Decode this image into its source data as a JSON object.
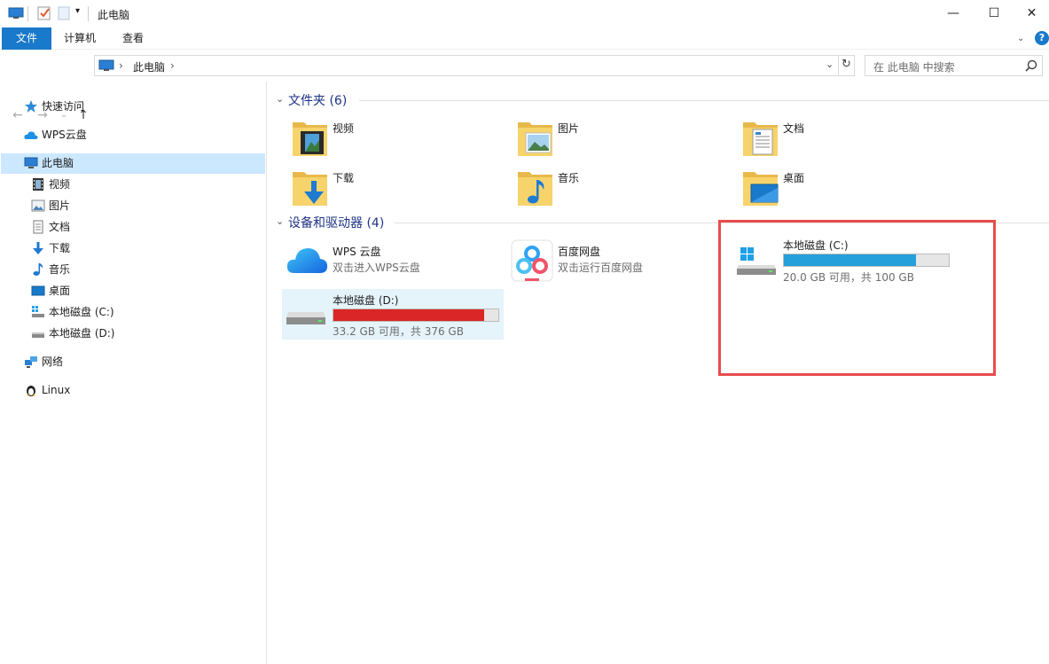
{
  "window": {
    "title": "此电脑",
    "minimize_glyph": "—",
    "maximize_glyph": "☐",
    "close_glyph": "✕"
  },
  "ribbon": {
    "tabs": [
      {
        "label": "文件"
      },
      {
        "label": "计算机"
      },
      {
        "label": "查看"
      }
    ],
    "help_glyph": "?"
  },
  "address_bar": {
    "path": "此电脑",
    "separator": "›",
    "search_placeholder": "在 此电脑 中搜索"
  },
  "sidebar": {
    "items": [
      {
        "label": "快速访问",
        "icon": "star-icon"
      },
      {
        "label": "WPS云盘",
        "icon": "cloud-icon"
      },
      {
        "label": "此电脑",
        "icon": "computer-icon",
        "selected": true
      },
      {
        "label": "视频",
        "icon": "video-icon"
      },
      {
        "label": "图片",
        "icon": "picture-icon"
      },
      {
        "label": "文档",
        "icon": "document-icon"
      },
      {
        "label": "下载",
        "icon": "download-icon"
      },
      {
        "label": "音乐",
        "icon": "music-icon"
      },
      {
        "label": "桌面",
        "icon": "desktop-icon"
      },
      {
        "label": "本地磁盘 (C:)",
        "icon": "drive-c-icon"
      },
      {
        "label": "本地磁盘 (D:)",
        "icon": "drive-icon"
      },
      {
        "label": "网络",
        "icon": "network-icon"
      },
      {
        "label": "Linux",
        "icon": "linux-icon"
      }
    ]
  },
  "folders_group": {
    "title": "文件夹 (6)",
    "items": [
      {
        "label": "视频",
        "icon": "video-folder-icon"
      },
      {
        "label": "图片",
        "icon": "picture-folder-icon"
      },
      {
        "label": "文档",
        "icon": "document-folder-icon"
      },
      {
        "label": "下载",
        "icon": "download-folder-icon"
      },
      {
        "label": "音乐",
        "icon": "music-folder-icon"
      },
      {
        "label": "桌面",
        "icon": "desktop-folder-icon"
      }
    ]
  },
  "devices_group": {
    "title": "设备和驱动器 (4)",
    "items": [
      {
        "name": "WPS 云盘",
        "subtitle": "双击进入WPS云盘",
        "icon": "wps-cloud-icon"
      },
      {
        "name": "百度网盘",
        "subtitle": "双击运行百度网盘",
        "icon": "baidu-netdisk-icon"
      },
      {
        "name": "本地磁盘 (C:)",
        "subtitle": "20.0 GB 可用，共 100 GB",
        "icon": "drive-c-icon",
        "used_fraction": 0.8,
        "bar_color": "#26a0da"
      },
      {
        "name": "本地磁盘 (D:)",
        "subtitle": "33.2 GB 可用，共 376 GB",
        "icon": "drive-icon",
        "used_fraction": 0.912,
        "bar_color": "#da2626"
      }
    ]
  },
  "colors": {
    "accent": "#1979ca",
    "selection_bg": "#cce8ff",
    "highlight_box": "#e84c4c",
    "group_title": "#1e3287"
  }
}
